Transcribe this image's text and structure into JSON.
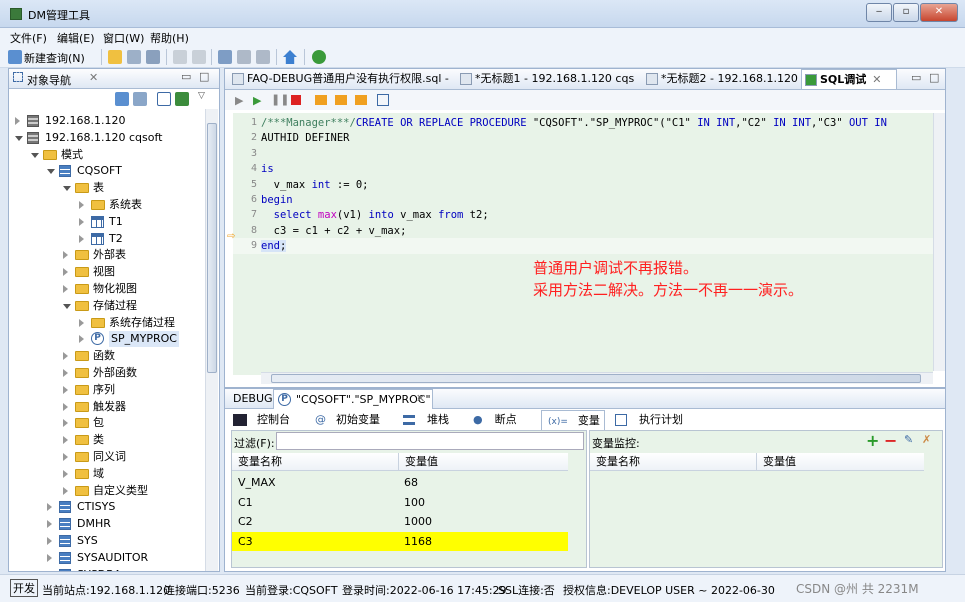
{
  "window": {
    "title": "DM管理工具",
    "controls": [
      "minimize",
      "maximize",
      "close"
    ]
  },
  "menu": [
    "文件(F)",
    "编辑(E)",
    "窗口(W)",
    "帮助(H)"
  ],
  "toolbar": {
    "new_query_label": "新建查询(N)"
  },
  "navigator": {
    "tab_label": "对象导航",
    "tree": [
      {
        "label": "192.168.1.120",
        "icon": "server-icon",
        "depth": 0,
        "state": "closed"
      },
      {
        "label": "192.168.1.120 cqsoft",
        "icon": "server-icon",
        "depth": 0,
        "state": "open"
      },
      {
        "label": "模式",
        "icon": "folder-icon",
        "depth": 1,
        "state": "open"
      },
      {
        "label": "CQSOFT",
        "icon": "schema-icon",
        "depth": 2,
        "state": "open"
      },
      {
        "label": "表",
        "icon": "folder-icon",
        "depth": 3,
        "state": "open"
      },
      {
        "label": "系统表",
        "icon": "folder-icon",
        "depth": 4,
        "state": "closed"
      },
      {
        "label": "T1",
        "icon": "table-icon",
        "depth": 4,
        "state": "closed"
      },
      {
        "label": "T2",
        "icon": "table-icon",
        "depth": 4,
        "state": "closed"
      },
      {
        "label": "外部表",
        "icon": "folder-icon",
        "depth": 3,
        "state": "closed"
      },
      {
        "label": "视图",
        "icon": "folder-icon",
        "depth": 3,
        "state": "closed"
      },
      {
        "label": "物化视图",
        "icon": "folder-icon",
        "depth": 3,
        "state": "closed"
      },
      {
        "label": "存储过程",
        "icon": "folder-icon",
        "depth": 3,
        "state": "open"
      },
      {
        "label": "系统存储过程",
        "icon": "folder-icon",
        "depth": 4,
        "state": "closed"
      },
      {
        "label": "SP_MYPROC",
        "icon": "procedure-icon",
        "depth": 4,
        "state": "closed",
        "selected": true
      },
      {
        "label": "函数",
        "icon": "folder-icon",
        "depth": 3,
        "state": "closed"
      },
      {
        "label": "外部函数",
        "icon": "folder-icon",
        "depth": 3,
        "state": "closed"
      },
      {
        "label": "序列",
        "icon": "folder-icon",
        "depth": 3,
        "state": "closed"
      },
      {
        "label": "触发器",
        "icon": "folder-icon",
        "depth": 3,
        "state": "closed"
      },
      {
        "label": "包",
        "icon": "folder-icon",
        "depth": 3,
        "state": "closed"
      },
      {
        "label": "类",
        "icon": "folder-icon",
        "depth": 3,
        "state": "closed"
      },
      {
        "label": "同义词",
        "icon": "folder-icon",
        "depth": 3,
        "state": "closed"
      },
      {
        "label": "域",
        "icon": "folder-icon",
        "depth": 3,
        "state": "closed"
      },
      {
        "label": "自定义类型",
        "icon": "folder-icon",
        "depth": 3,
        "state": "closed"
      },
      {
        "label": "CTISYS",
        "icon": "schema-icon",
        "depth": 2,
        "state": "closed"
      },
      {
        "label": "DMHR",
        "icon": "schema-icon",
        "depth": 2,
        "state": "closed"
      },
      {
        "label": "SYS",
        "icon": "schema-icon",
        "depth": 2,
        "state": "closed"
      },
      {
        "label": "SYSAUDITOR",
        "icon": "schema-icon",
        "depth": 2,
        "state": "closed"
      },
      {
        "label": "SYSDBA",
        "icon": "schema-icon",
        "depth": 2,
        "state": "closed"
      }
    ]
  },
  "editor": {
    "tabs": [
      {
        "label": "FAQ-DEBUG普通用户没有执行权限.sql -",
        "active": false
      },
      {
        "label": "*无标题1 - 192.168.1.120 cqs",
        "active": false
      },
      {
        "label": "*无标题2 - 192.168.1.120",
        "active": false
      },
      {
        "label": "SQL调试",
        "active": true
      }
    ],
    "code_lines": [
      {
        "n": "1",
        "segs": [
          [
            "cm",
            "/***Manager***/"
          ],
          [
            "kw",
            "CREATE OR REPLACE PROCEDURE "
          ],
          [
            "st",
            "\"CQSOFT\".\"SP_MYPROC\"(\"C1\" "
          ],
          [
            "kw",
            "IN INT"
          ],
          [
            "st",
            ",\"C2\" "
          ],
          [
            "kw",
            "IN INT"
          ],
          [
            "st",
            ",\"C3\" "
          ],
          [
            "kw",
            "OUT IN"
          ]
        ]
      },
      {
        "n": "2",
        "segs": [
          [
            "st",
            "AUTHID DEFINER"
          ]
        ]
      },
      {
        "n": "3",
        "segs": []
      },
      {
        "n": "4",
        "segs": [
          [
            "kw",
            "is"
          ]
        ]
      },
      {
        "n": "5",
        "segs": [
          [
            "st",
            "  v_max "
          ],
          [
            "kw",
            "int"
          ],
          [
            "st",
            " := 0;"
          ]
        ]
      },
      {
        "n": "6",
        "segs": [
          [
            "kw",
            "begin"
          ]
        ]
      },
      {
        "n": "7",
        "segs": [
          [
            "st",
            "  "
          ],
          [
            "kw",
            "select "
          ],
          [
            "fn",
            "max"
          ],
          [
            "st",
            "(v1) "
          ],
          [
            "kw",
            "into"
          ],
          [
            "st",
            " v_max "
          ],
          [
            "kw",
            "from"
          ],
          [
            "st",
            " t2;"
          ]
        ]
      },
      {
        "n": "8",
        "segs": [
          [
            "st",
            "  c3 = c1 + c2 + v_max;"
          ]
        ]
      },
      {
        "n": "9",
        "segs": [
          [
            "kw",
            "end"
          ],
          [
            "st",
            ";"
          ]
        ],
        "current": true
      }
    ],
    "annotation": [
      "普通用户调试不再报错。",
      "采用方法二解决。方法一不再一一演示。"
    ]
  },
  "debug": {
    "tab_label": "DEBUG",
    "proc_tab": "\"CQSOFT\".\"SP_MYPROC\"",
    "subtabs": [
      "控制台",
      "初始变量",
      "堆栈",
      "断点",
      "变量",
      "执行计划"
    ],
    "active_subtab": "变量",
    "filter_label": "过滤(F):",
    "filter_value": "",
    "var_columns": [
      "变量名称",
      "变量值"
    ],
    "variables": [
      {
        "name": "V_MAX",
        "value": "68"
      },
      {
        "name": "C1",
        "value": "100"
      },
      {
        "name": "C2",
        "value": "1000"
      },
      {
        "name": "C3",
        "value": "1168",
        "highlight": true
      }
    ],
    "monitor_label": "变量监控:",
    "monitor_columns": [
      "变量名称",
      "变量值"
    ]
  },
  "statusbar": {
    "mode": "开发",
    "site": "当前站点:192.168.1.120",
    "port": "连接端口:5236",
    "login": "当前登录:CQSOFT",
    "login_time": "登录时间:2022-06-16 17:45:29",
    "ssl": "SSL连接:否",
    "license": "授权信息:DEVELOP USER ~ 2022-06-30",
    "watermark": "CSDN @州 共 2231M"
  },
  "colors": {
    "code_bg": "#e8f3e8",
    "highlight": "#ffff00",
    "annotation": "#ff2020",
    "keyword": "#0000c0"
  }
}
